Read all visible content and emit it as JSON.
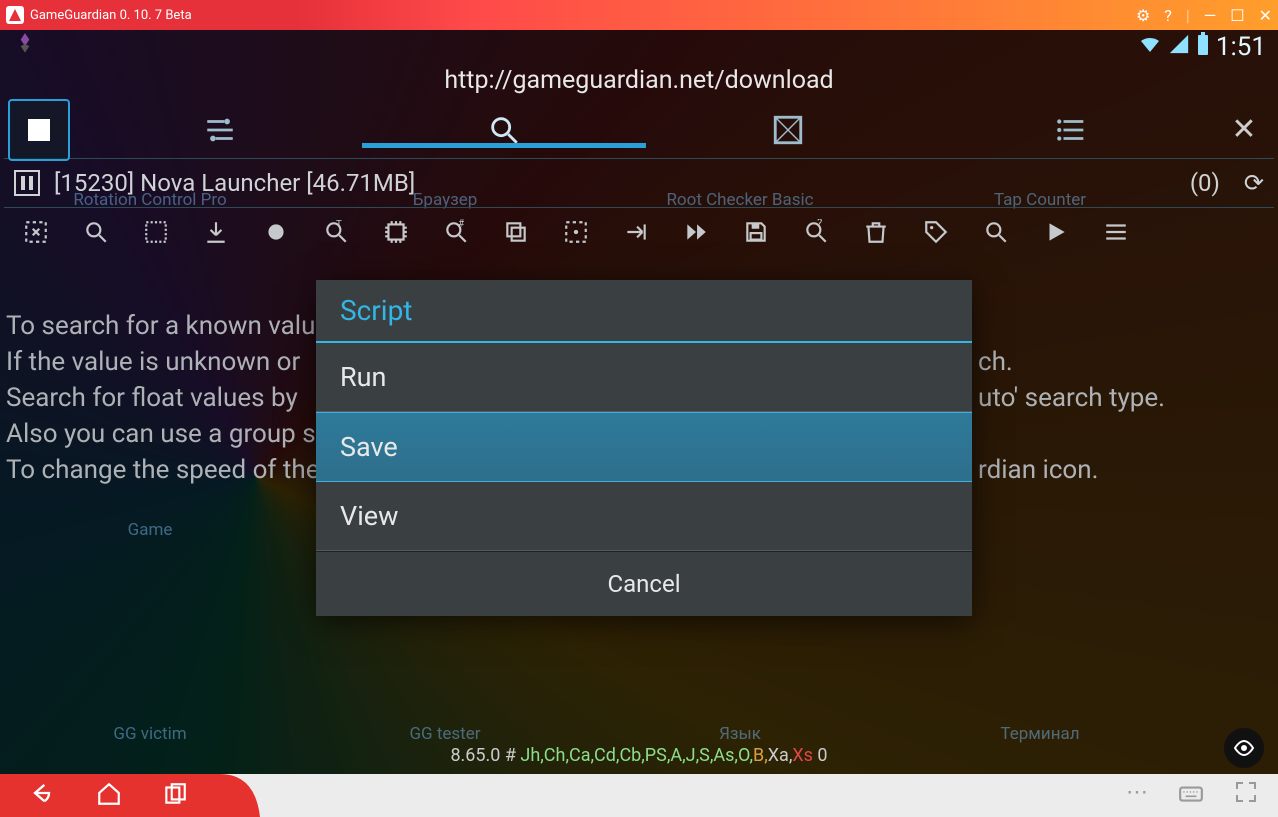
{
  "titlebar": {
    "title": "GameGuardian 0. 10. 7 Beta"
  },
  "statusbar": {
    "clock": "1:51"
  },
  "url": "http://gameguardian.net/download",
  "process": {
    "pid_label": "[15230] Nova Launcher [46.71MB]",
    "count": "(0)"
  },
  "help": {
    "l1": "To search for a known valu",
    "l2": "If the value is unknown or",
    "l3": "Search for float values by",
    "l4": "Also you can use a group s",
    "l5": "To change the speed of the",
    "r2": "ch.",
    "r3": "uto' search type.",
    "r5": "rdian icon."
  },
  "dialog": {
    "title": "Script",
    "items": [
      "Run",
      "Save",
      "View"
    ],
    "selected": 1,
    "cancel": "Cancel"
  },
  "bg_apps": {
    "a1": "Rotation Control Pro",
    "a2": "Браузер",
    "a3": "Root Checker Basic",
    "a4": "Tap Counter",
    "a5": "Game",
    "a6": "GG victim",
    "a7": "GG tester",
    "a8": "Язык",
    "a9": "Терминал"
  },
  "version": {
    "plain": "8.65.0 ",
    "hash": "# ",
    "green": "Jh,Ch,Ca,Cd,Cb,PS,A,J,S,As,O,",
    "b": "B,",
    "xa": "Xa,",
    "xs": "Xs",
    "tail": " 0"
  }
}
